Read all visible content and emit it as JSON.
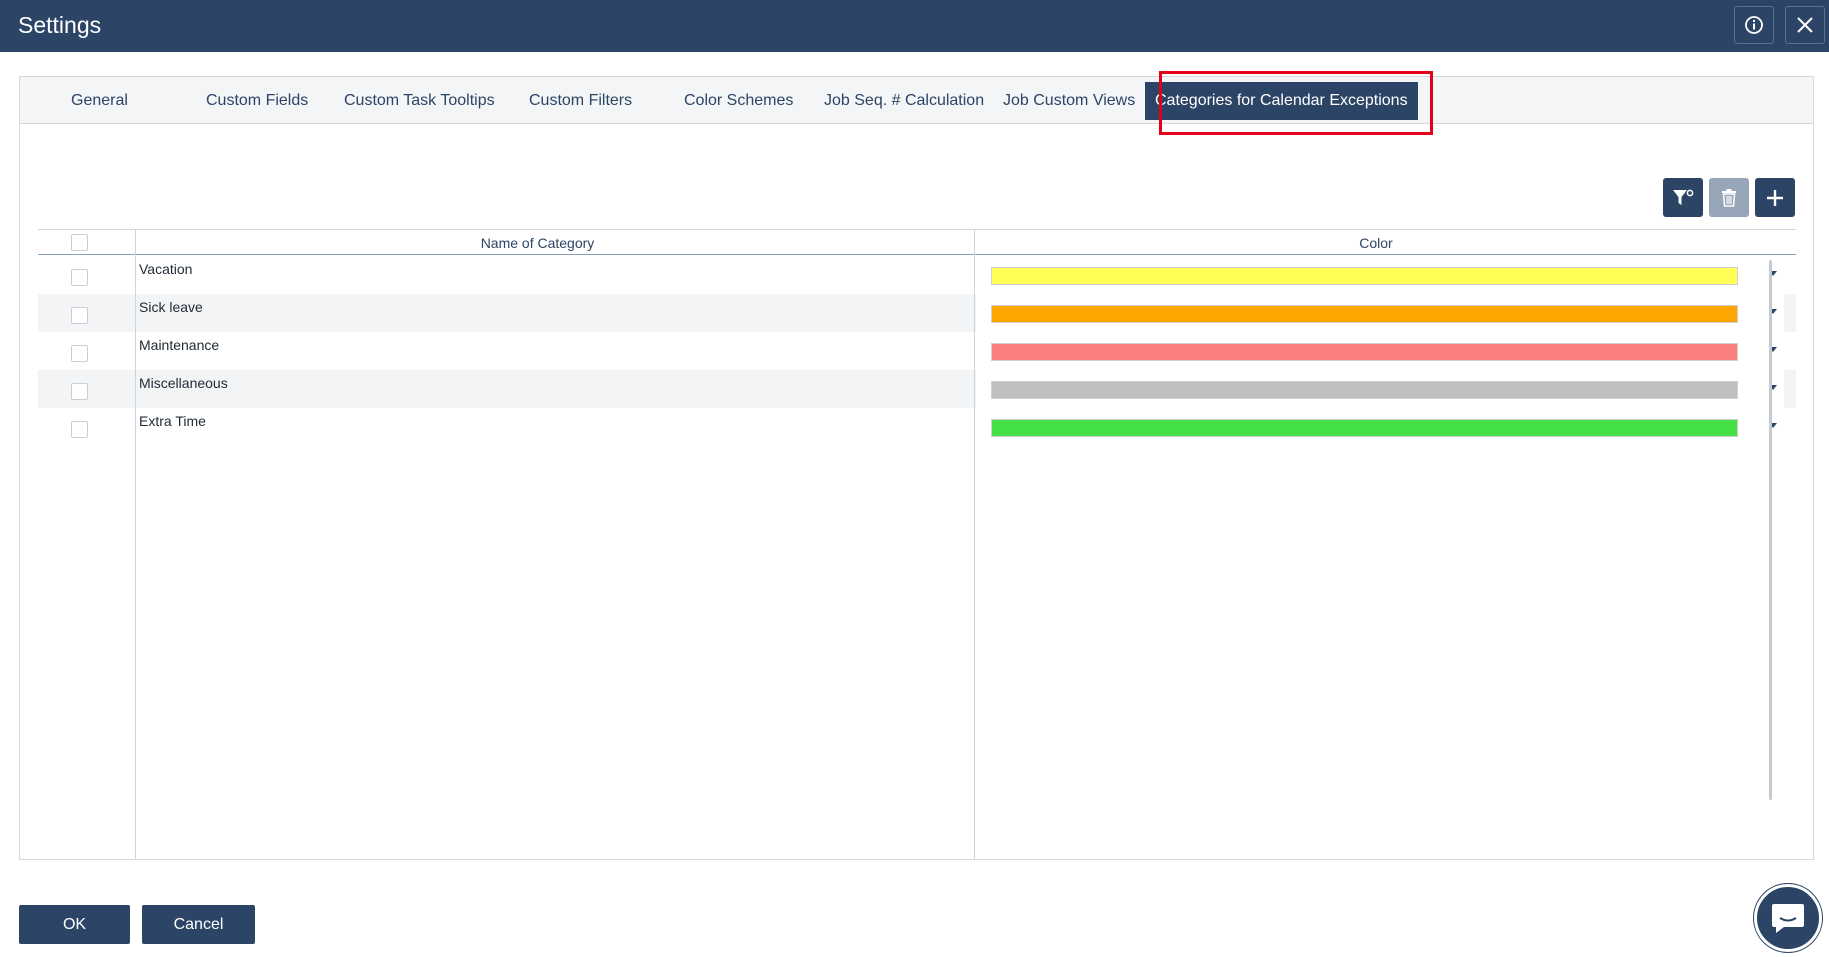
{
  "window": {
    "title": "Settings"
  },
  "tabs": [
    {
      "label": "General"
    },
    {
      "label": "Custom Fields"
    },
    {
      "label": "Custom Task Tooltips"
    },
    {
      "label": "Custom Filters"
    },
    {
      "label": "Color Schemes"
    },
    {
      "label": "Job Seq. # Calculation"
    },
    {
      "label": "Job Custom Views"
    },
    {
      "label": "Categories for Calendar Exceptions",
      "active": true
    }
  ],
  "toolbar": {
    "icons": [
      "filter-settings-icon",
      "trash-icon",
      "plus-icon"
    ],
    "delete_disabled": true
  },
  "grid": {
    "columns": {
      "name": "Name of Category",
      "color": "Color"
    },
    "rows": [
      {
        "name": "Vacation",
        "color": "#ffff55"
      },
      {
        "name": "Sick leave",
        "color": "#ffa500"
      },
      {
        "name": "Maintenance",
        "color": "#fa8080"
      },
      {
        "name": "Miscellaneous",
        "color": "#c0c0c0"
      },
      {
        "name": "Extra Time",
        "color": "#44e044"
      }
    ]
  },
  "footer": {
    "ok_label": "OK",
    "cancel_label": "Cancel"
  },
  "colors": {
    "primary": "#2c4466",
    "highlight": "#e3001b"
  }
}
